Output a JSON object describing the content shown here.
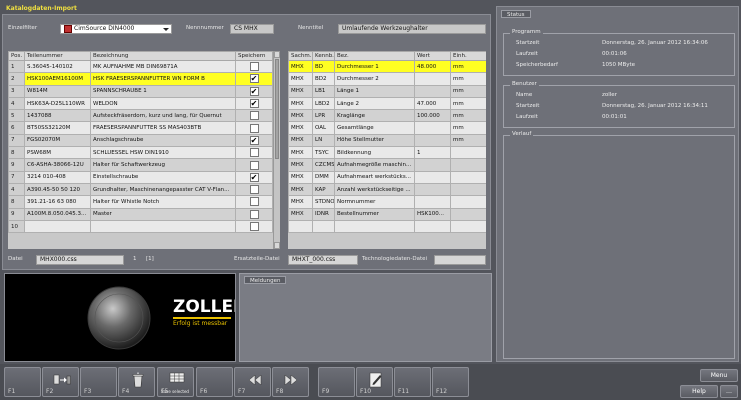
{
  "window": {
    "title": "Katalogdaten-Import"
  },
  "filters": {
    "einzelfilter_label": "Einzelfilter",
    "einzelfilter_value": "CimSource DIN4000",
    "nennnummer_label": "Nennnummer",
    "nennnummer_value": "CS MHX",
    "nenntitel_label": "Nenntitel",
    "nenntitel_value": "Umlaufende Werkzeughalter"
  },
  "left_table": {
    "headers": [
      "Pos.",
      "Teilenummer",
      "Bezeichnung",
      "Speichern"
    ],
    "rows": [
      {
        "pos": "1",
        "part": "S.36045-140102",
        "desc": "MK AUFNAHME MB DIN69871A",
        "save": false,
        "state": "even"
      },
      {
        "pos": "2",
        "part": "HSK100AEM16100M",
        "desc": "HSK FRAESERSPANNFUTTER WN FORM B",
        "save": true,
        "state": "sel"
      },
      {
        "pos": "3",
        "part": "W814M",
        "desc": "SPANNSCHRAUBE 1",
        "save": true,
        "state": "odd"
      },
      {
        "pos": "4",
        "part": "HSK63A-D25L110WR",
        "desc": "WELDON",
        "save": true,
        "state": "even"
      },
      {
        "pos": "5",
        "part": "1437088",
        "desc": "Aufsteckfräserdorn, kurz und lang, für Quernut",
        "save": false,
        "state": "odd"
      },
      {
        "pos": "6",
        "part": "BT50SS32120M",
        "desc": "FRAESERSPANNFUTTER SS MAS403BTB",
        "save": false,
        "state": "even"
      },
      {
        "pos": "7",
        "part": "FGS02070M",
        "desc": "Anschlagschraube",
        "save": true,
        "state": "odd"
      },
      {
        "pos": "8",
        "part": "PSW68M",
        "desc": "SCHLUESSEL HSW DIN1910",
        "save": false,
        "state": "even"
      },
      {
        "pos": "9",
        "part": "C6-ASHA-38066-12U",
        "desc": "Halter für Schaftwerkzeug",
        "save": false,
        "state": "odd"
      },
      {
        "pos": "7",
        "part": "3214 010-408",
        "desc": "Einstellschraube",
        "save": true,
        "state": "even"
      },
      {
        "pos": "4",
        "part": "A390.45-50 50 120",
        "desc": "Grundhalter, Maschinenangepasster CAT V-Flan...",
        "save": false,
        "state": "odd"
      },
      {
        "pos": "8",
        "part": "391.21-16 63 080",
        "desc": "Halter für Whistle Notch",
        "save": false,
        "state": "even"
      },
      {
        "pos": "9",
        "part": "A100M.8.050.045.3...",
        "desc": "Master",
        "save": false,
        "state": "odd"
      },
      {
        "pos": "10",
        "part": "",
        "desc": "",
        "save": false,
        "state": "even"
      }
    ]
  },
  "right_table": {
    "headers": [
      "Sachm.",
      "Kennb.",
      "Bez.",
      "Wert",
      "Einh."
    ],
    "rows": [
      {
        "s": "MHX",
        "k": "BD",
        "b": "Durchmesser 1",
        "w": "48.000",
        "e": "mm",
        "state": "sel"
      },
      {
        "s": "MHX",
        "k": "BD2",
        "b": "Durchmesser 2",
        "w": "",
        "e": "mm",
        "state": "even"
      },
      {
        "s": "MHX",
        "k": "LB1",
        "b": "Länge 1",
        "w": "",
        "e": "mm",
        "state": "odd"
      },
      {
        "s": "MHX",
        "k": "LBD2",
        "b": "Länge 2",
        "w": "47.000",
        "e": "mm",
        "state": "even"
      },
      {
        "s": "MHX",
        "k": "LPR",
        "b": "Kraglänge",
        "w": "100.000",
        "e": "mm",
        "state": "odd"
      },
      {
        "s": "MHX",
        "k": "OAL",
        "b": "Gesamtlänge",
        "w": "",
        "e": "mm",
        "state": "even"
      },
      {
        "s": "MHX",
        "k": "LN",
        "b": "Höhe Stellmutter",
        "w": "",
        "e": "mm",
        "state": "odd"
      },
      {
        "s": "MHX",
        "k": "TSYC",
        "b": "Bildkennung",
        "w": "1",
        "e": "",
        "state": "even"
      },
      {
        "s": "MHX",
        "k": "CZCMS",
        "b": "Aufnahmegröße maschin...",
        "w": "",
        "e": "",
        "state": "odd"
      },
      {
        "s": "MHX",
        "k": "DMM",
        "b": "Aufnahmeart werkstücks...",
        "w": "",
        "e": "",
        "state": "even"
      },
      {
        "s": "MHX",
        "k": "KAP",
        "b": "Anzahl werkstückseitige ...",
        "w": "",
        "e": "",
        "state": "odd"
      },
      {
        "s": "MHX",
        "k": "STDNO",
        "b": "Normnummer",
        "w": "",
        "e": "",
        "state": "even"
      },
      {
        "s": "MHX",
        "k": "IDNR",
        "b": "Bestellnummer",
        "w": "HSK100...",
        "e": "",
        "state": "odd"
      },
      {
        "s": "",
        "k": "",
        "b": "",
        "w": "",
        "e": "",
        "state": "even"
      }
    ]
  },
  "files": {
    "datei_label": "Datei",
    "datei_value": "MHX000.css",
    "count": "1",
    "count_bracket": "[1]",
    "ersatz_label": "Ersatzteile-Datei",
    "ersatz_value": "MHXT_000.css",
    "techno_label": "Technologiedaten-Datei",
    "techno_value": ""
  },
  "preview": {
    "logo_text": "ZOLLER",
    "tagline": "Erfolg ist messbar"
  },
  "messages": {
    "title": "Meldungen"
  },
  "status": {
    "title": "Status",
    "programm": {
      "title": "Programm",
      "rows": [
        {
          "k": "Startzeit",
          "v": "Donnerstag, 26. Januar 2012 16:34:06"
        },
        {
          "k": "Laufzeit",
          "v": "00:01:06"
        },
        {
          "k": "Speicherbedarf",
          "v": "1050 MByte"
        }
      ]
    },
    "benutzer": {
      "title": "Benutzer",
      "rows": [
        {
          "k": "Name",
          "v": "zoller"
        },
        {
          "k": "Startzeit",
          "v": "Donnerstag, 26. Januar 2012 16:34:11"
        },
        {
          "k": "Laufzeit",
          "v": "00:01:01"
        }
      ]
    },
    "verlauf": {
      "title": "Verlauf"
    }
  },
  "fkeys": [
    "F1",
    "F2",
    "F3",
    "F4",
    "F5",
    "F6",
    "F7",
    "F8",
    "F9",
    "F10",
    "F11",
    "F12"
  ],
  "fkey_f5_caption": "Save selected",
  "side_buttons": {
    "menu": "Menu",
    "help": "Help"
  },
  "colors": {
    "selection": "#ffff22",
    "title_accent": "#f0e040"
  }
}
